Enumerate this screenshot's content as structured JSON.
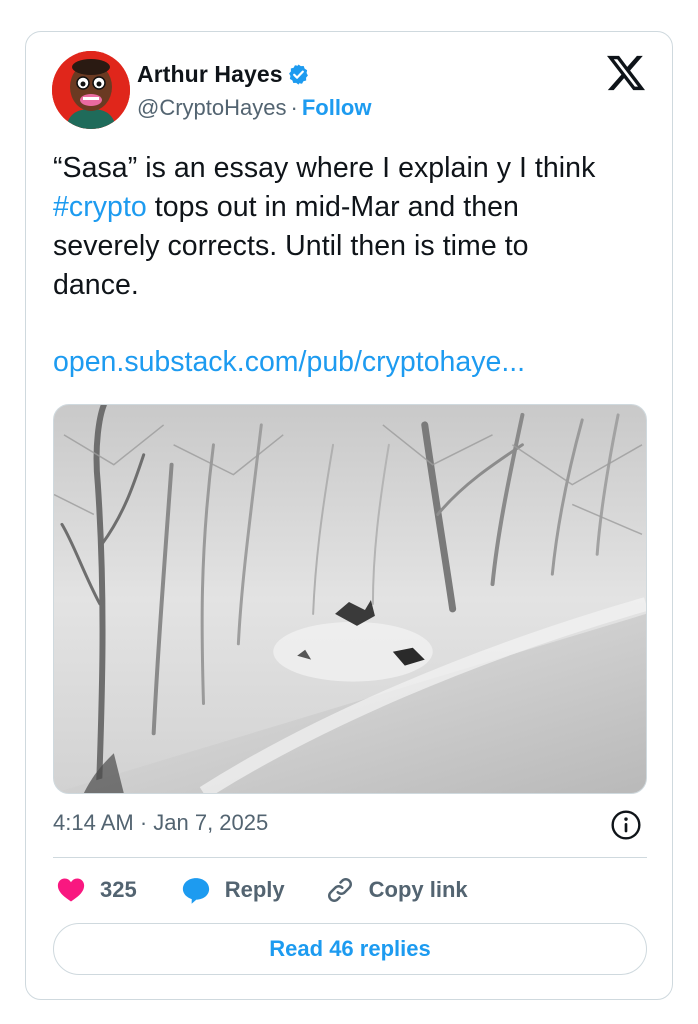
{
  "author": {
    "name": "Arthur Hayes",
    "handle": "@CryptoHayes",
    "separator": "·",
    "follow_label": "Follow",
    "avatar_icon": "cartoon-avatar",
    "verified_icon": "verified-badge-icon"
  },
  "brand": {
    "logo": "x-logo"
  },
  "tweet": {
    "line1": "“Sasa” is an essay where I explain y I think",
    "hashtag": "#crypto",
    "line2_rest": " tops out in mid-Mar and then",
    "line3": "severely corrects. Until then is time to",
    "line4": "dance.",
    "link": "open.substack.com/pub/cryptohaye..."
  },
  "media": {
    "description_icon": "snowy-forest-photo"
  },
  "timestamp": "4:14 AM · Jan 7, 2025",
  "actions": {
    "like_count": "325",
    "reply_label": "Reply",
    "copy_link_label": "Copy link"
  },
  "read_replies_label": "Read 46 replies",
  "colors": {
    "accent": "#1d9bf0",
    "like": "#f91880",
    "text": "#0f1419",
    "secondary": "#536471",
    "border": "#cfd9de"
  }
}
